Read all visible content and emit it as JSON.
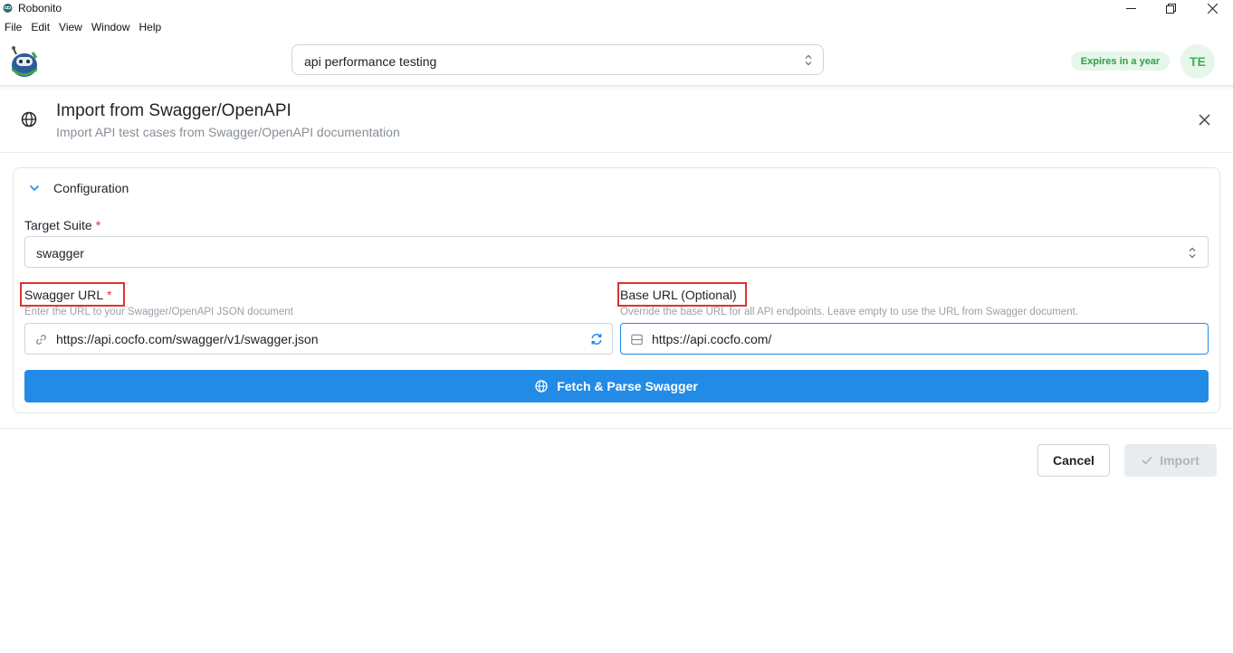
{
  "window": {
    "title": "Robonito",
    "controls": [
      "minimize-icon",
      "restore-icon",
      "close-icon"
    ]
  },
  "menu": [
    "File",
    "Edit",
    "View",
    "Window",
    "Help"
  ],
  "header": {
    "project_select_value": "api performance testing",
    "expiry_badge": "Expires in a year",
    "avatar_initials": "TE",
    "colors": {
      "badge_bg": "#e7f6ea",
      "badge_text": "#2f9e44"
    }
  },
  "dialog": {
    "icon": "globe-icon",
    "title": "Import from Swagger/OpenAPI",
    "subtitle": "Import API test cases from Swagger/OpenAPI documentation",
    "config": {
      "section_title": "Configuration",
      "target_suite": {
        "label": "Target Suite",
        "required": "*",
        "value": "swagger"
      },
      "swagger_url": {
        "label": "Swagger URL",
        "required": "*",
        "hint": "Enter the URL to your Swagger/OpenAPI JSON document",
        "value": "https://api.cocfo.com/swagger/v1/swagger.json"
      },
      "base_url": {
        "label": "Base URL (Optional)",
        "hint": "Override the base URL for all API endpoints. Leave empty to use the URL from Swagger document.",
        "value": "https://api.cocfo.com/"
      },
      "fetch_button": "Fetch & Parse Swagger"
    },
    "footer": {
      "cancel_label": "Cancel",
      "import_label": "Import",
      "import_disabled": true
    },
    "colors": {
      "primary": "#228be6",
      "highlight": "#e03131"
    }
  }
}
